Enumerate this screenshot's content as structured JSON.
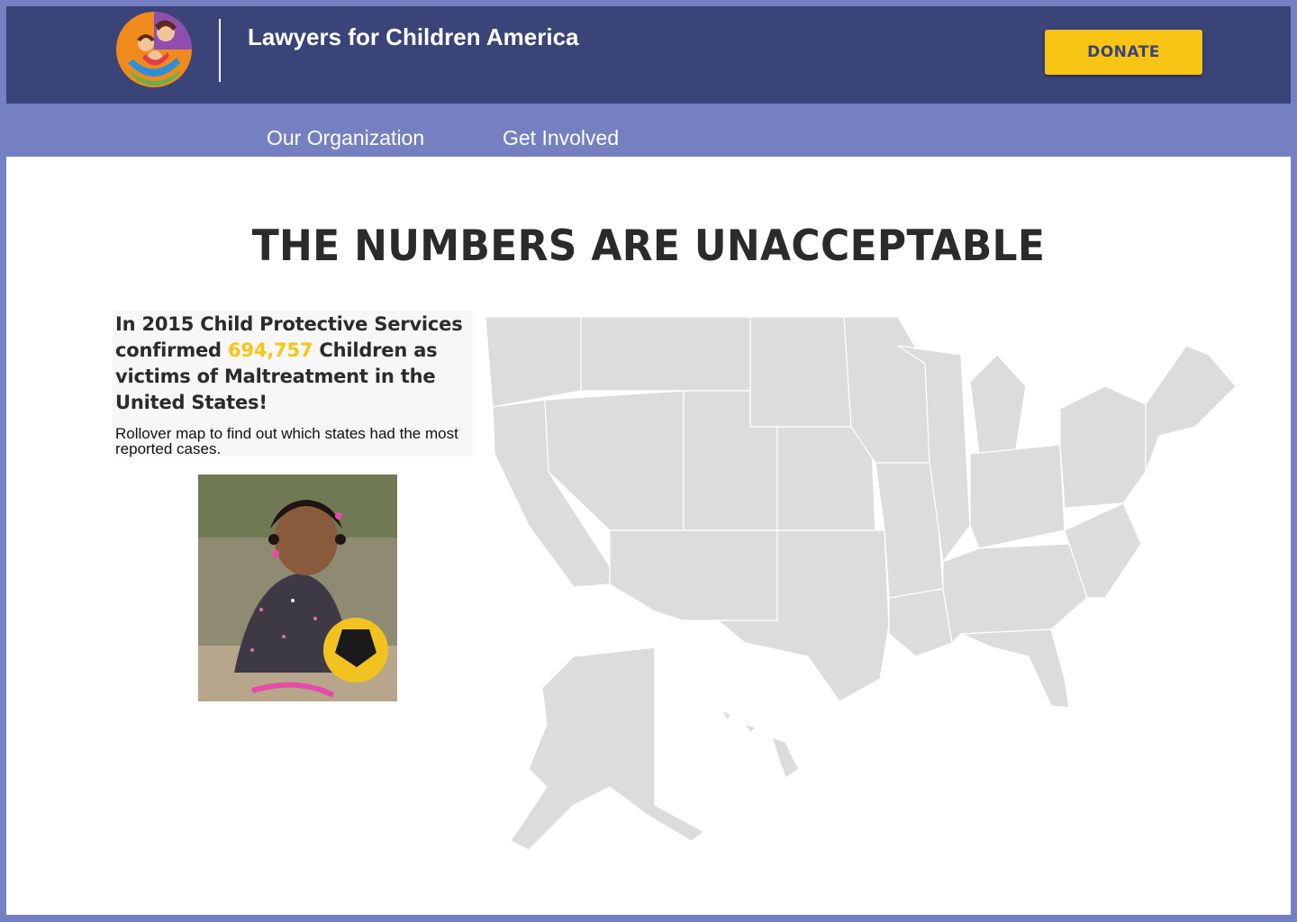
{
  "header": {
    "site_title": "Lawyers for Children America",
    "donate_label": "DONATE",
    "logo_icon": "family-hug-logo"
  },
  "nav": {
    "items": [
      {
        "label": "Our Organization"
      },
      {
        "label": "Get Involved"
      }
    ]
  },
  "main": {
    "headline": "THE NUMBERS ARE UNACCEPTABLE",
    "stat": {
      "before": "In 2015 Child Protective Services confirmed ",
      "number": "694,757",
      "after": " Children as victims of Maltreatment in the United States!"
    },
    "rollover_text": "Rollover map to find out which states had the most reported cases.",
    "photo_icon": "child-with-soccer-ball-photo",
    "map_icon": "us-states-map"
  },
  "colors": {
    "header_bg": "#3a4479",
    "nav_bg": "#7580c3",
    "accent_yellow": "#f9c514",
    "map_fill": "#dcdcdc"
  }
}
